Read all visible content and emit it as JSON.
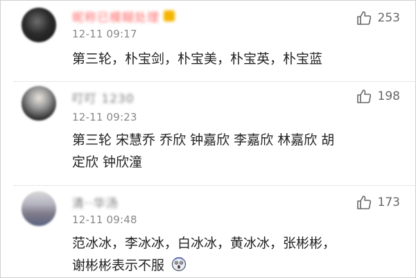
{
  "comments": [
    {
      "username": "昵称已模糊处理",
      "time": "12-11 09:17",
      "likes": "253",
      "text": "第三轮，朴宝剑，朴宝美，朴宝英，朴宝蓝"
    },
    {
      "username": "叮叮 1230",
      "time": "12-11 09:23",
      "likes": "198",
      "text_line1": "第三轮 宋慧乔 乔欣  钟嘉欣 李嘉欣 林嘉欣 胡",
      "text_line2": "定欣 钟欣潼"
    },
    {
      "username": "清··华汤",
      "time": "12-11 09:48",
      "likes": "173",
      "text_line1": "范冰冰，李冰冰，白冰冰，黄冰冰，张彬彬，",
      "text_line2": "谢彬彬表示不服"
    }
  ],
  "icons": {
    "like": "thumbs-up-icon",
    "emoji": "shocked-face-emoji-icon"
  },
  "colors": {
    "text": "#222222",
    "meta": "#888888",
    "like": "#666666",
    "username_highlight": "#ff6a6a"
  }
}
